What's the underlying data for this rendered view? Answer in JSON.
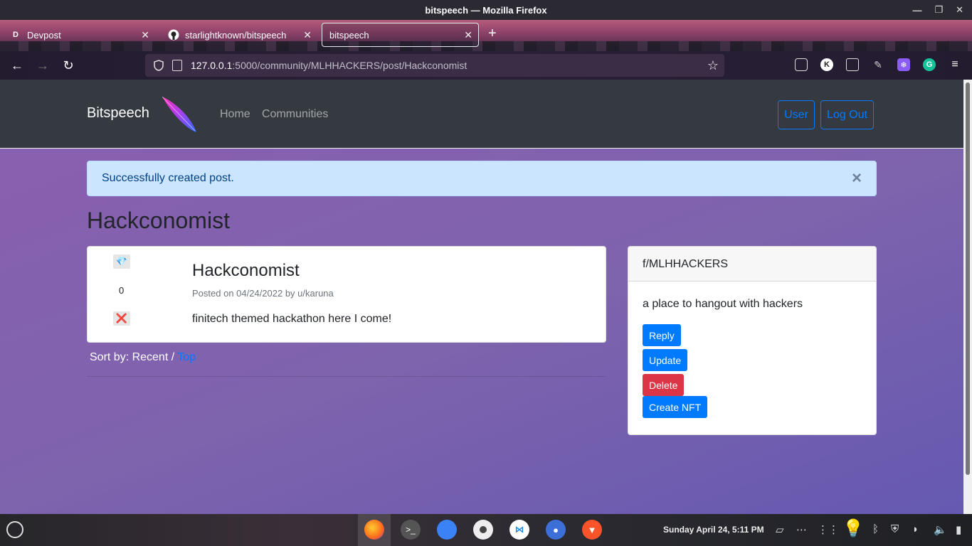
{
  "browser": {
    "window_title": "bitspeech — Mozilla Firefox",
    "tabs": [
      {
        "label": "Devpost",
        "favicon": "D"
      },
      {
        "label": "starlightknown/bitspeech",
        "favicon": "github-icon"
      },
      {
        "label": "bitspeech",
        "favicon": ""
      }
    ],
    "url_host": "127.0.0.1",
    "url_rest": ":5000/community/MLHHACKERS/post/Hackconomist",
    "ext_k": "K",
    "ext_g": "G"
  },
  "site": {
    "brand": "Bitspeech",
    "nav": {
      "home": "Home",
      "communities": "Communities"
    },
    "user_button": "User",
    "logout_button": "Log Out"
  },
  "alert": {
    "message": "Successfully created post.",
    "close": "×"
  },
  "page": {
    "heading": "Hackconomist"
  },
  "post": {
    "upvote_icon": "💎",
    "downvote_icon": "❌",
    "votes": "0",
    "title": "Hackconomist",
    "meta": "Posted on 04/24/2022 by u/karuna",
    "body": "finitech themed hackathon here I come!"
  },
  "sort": {
    "prefix": "Sort by: Recent / ",
    "top": "Top"
  },
  "sidebar": {
    "community": "f/MLHHACKERS",
    "description": "a place to hangout with hackers",
    "buttons": {
      "reply": "Reply",
      "update": "Update",
      "delete": "Delete",
      "create_nft": "Create NFT"
    }
  },
  "taskbar": {
    "clock": "Sunday April 24,  5:11 PM"
  }
}
